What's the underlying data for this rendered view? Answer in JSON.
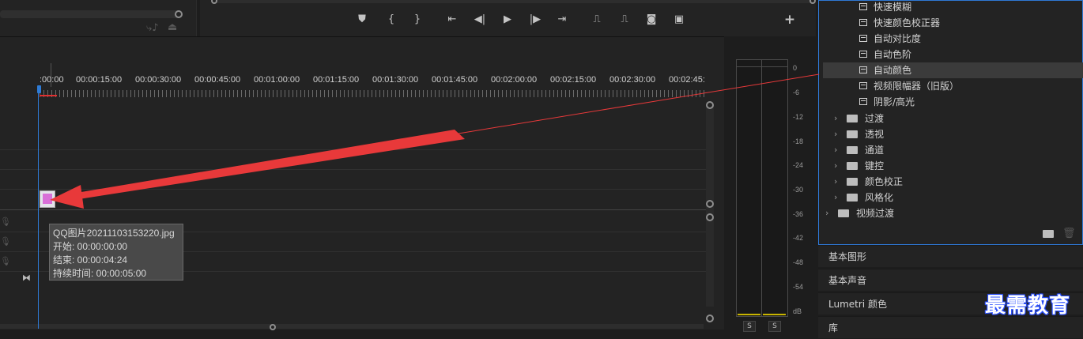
{
  "timeline": {
    "timecodes": [
      ":00:00",
      "00:00:15:00",
      "00:00:30:00",
      "00:00:45:00",
      "00:01:00:00",
      "00:01:15:00",
      "00:01:30:00",
      "00:01:45:00",
      "00:02:00:00",
      "00:02:15:00",
      "00:02:30:00",
      "00:02:45:"
    ],
    "clip_tooltip": {
      "filename": "QQ图片20211103153220.jpg",
      "start": "开始: 00:00:00:00",
      "end": "结束: 00:00:04:24",
      "duration": "持续时间: 00:00:05:00"
    }
  },
  "meter": {
    "db_labels": [
      "0",
      "-6",
      "-12",
      "-18",
      "-24",
      "-30",
      "-36",
      "-42",
      "-48",
      "-54",
      "dB"
    ],
    "solo_left": "S",
    "solo_right": "S"
  },
  "effects": {
    "items": [
      {
        "label": "快速模糊",
        "type": "effect"
      },
      {
        "label": "快速颜色校正器",
        "type": "effect"
      },
      {
        "label": "自动对比度",
        "type": "effect"
      },
      {
        "label": "自动色阶",
        "type": "effect"
      },
      {
        "label": "自动颜色",
        "type": "effect",
        "selected": true
      },
      {
        "label": "视频限幅器（旧版）",
        "type": "effect"
      },
      {
        "label": "阴影/高光",
        "type": "effect"
      },
      {
        "label": "过渡",
        "type": "folder"
      },
      {
        "label": "透视",
        "type": "folder"
      },
      {
        "label": "通道",
        "type": "folder"
      },
      {
        "label": "键控",
        "type": "folder"
      },
      {
        "label": "颜色校正",
        "type": "folder"
      },
      {
        "label": "风格化",
        "type": "folder"
      },
      {
        "label": "视频过渡",
        "type": "root-folder"
      }
    ]
  },
  "side_panels": {
    "essential_graphics": "基本图形",
    "essential_sound": "基本声音",
    "lumetri_color": "Lumetri 颜色",
    "libraries": "库"
  },
  "watermark": "最需教育",
  "colors": {
    "accent_blue": "#2e7bd6",
    "arrow_red": "#e8393a",
    "selection_bg": "#3b3b3b"
  }
}
